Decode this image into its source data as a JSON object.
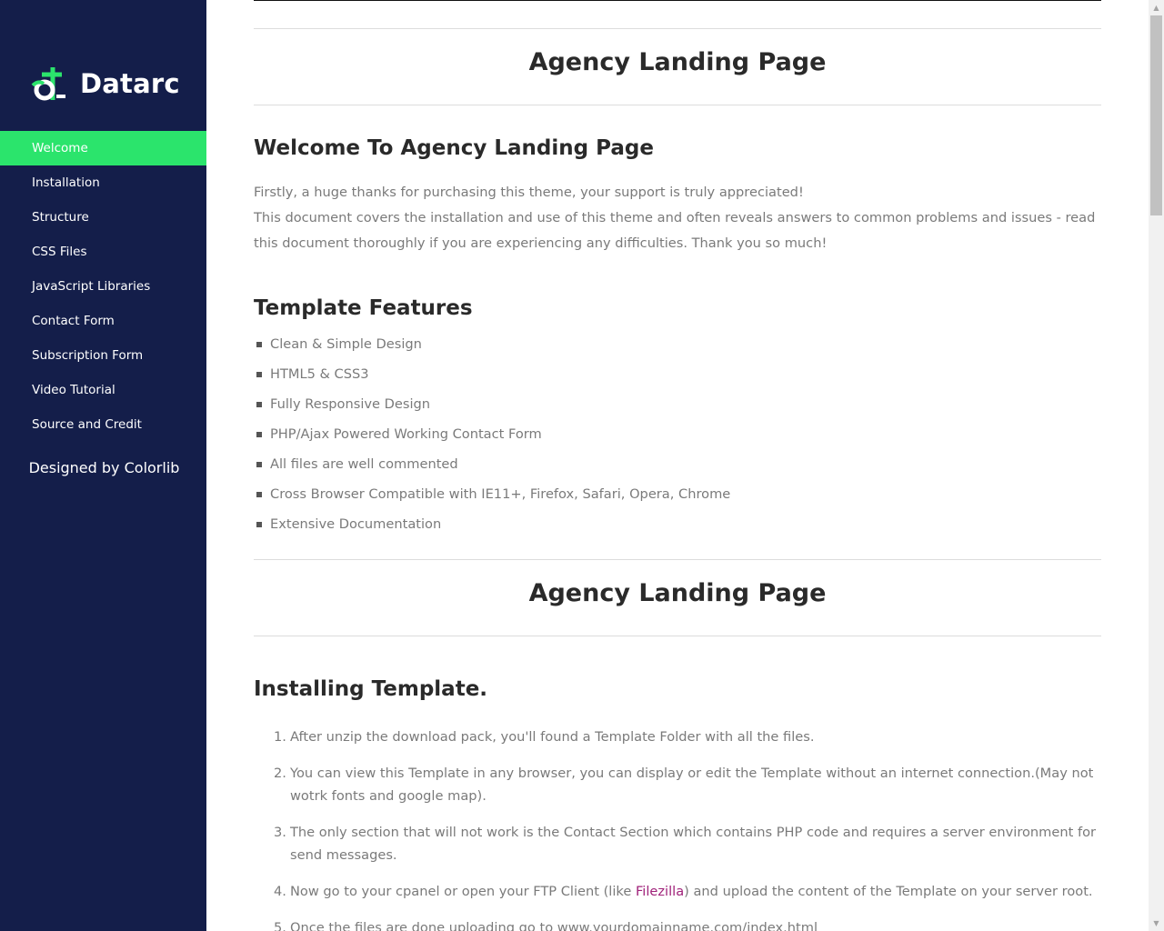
{
  "brand": {
    "name": "Datarc",
    "accent": "#2be46c",
    "sidebar_bg": "#141e4a"
  },
  "nav": [
    {
      "label": "Welcome",
      "active": true
    },
    {
      "label": "Installation"
    },
    {
      "label": "Structure"
    },
    {
      "label": "CSS Files"
    },
    {
      "label": "JavaScript Libraries"
    },
    {
      "label": "Contact Form"
    },
    {
      "label": "Subscription Form"
    },
    {
      "label": "Video Tutorial"
    },
    {
      "label": "Source and Credit"
    }
  ],
  "credit": "Designed by Colorlib",
  "welcome_section": {
    "page_title": "Agency Landing Page",
    "heading": "Welcome To Agency Landing Page",
    "para1": "Firstly, a huge thanks for purchasing this theme, your support is truly appreciated!",
    "para2": "This document covers the installation and use of this theme and often reveals answers to common problems and issues - read this document thoroughly if you are experiencing any difficulties. Thank you so much!",
    "features_heading": "Template Features",
    "features": [
      "Clean & Simple Design",
      "HTML5 & CSS3",
      "Fully Responsive Design",
      "PHP/Ajax Powered Working Contact Form",
      "All files are well commented",
      "Cross Browser Compatible with IE11+, Firefox, Safari, Opera, Chrome",
      "Extensive Documentation"
    ]
  },
  "install_section": {
    "page_title": "Agency Landing Page",
    "heading": "Installing Template.",
    "steps": [
      {
        "num": "1.",
        "text": "After unzip the download pack, you'll found a Template Folder with all the files."
      },
      {
        "num": "2.",
        "text": "You can view this Template in any browser, you can display or edit the Template without an internet connection.(May not wotrk fonts and google map)."
      },
      {
        "num": "3.",
        "text": "The only section that will not work is the Contact Section which contains PHP code and requires a server environment for send messages."
      },
      {
        "num": "4.",
        "text_before": "Now go to your cpanel or open your FTP Client (like ",
        "link": "Filezilla",
        "text_after": ") and upload the content of the Template on your server root."
      },
      {
        "num": "5.",
        "text": "Once the files are done uploading go to www.yourdomainname.com/index.html"
      }
    ]
  }
}
